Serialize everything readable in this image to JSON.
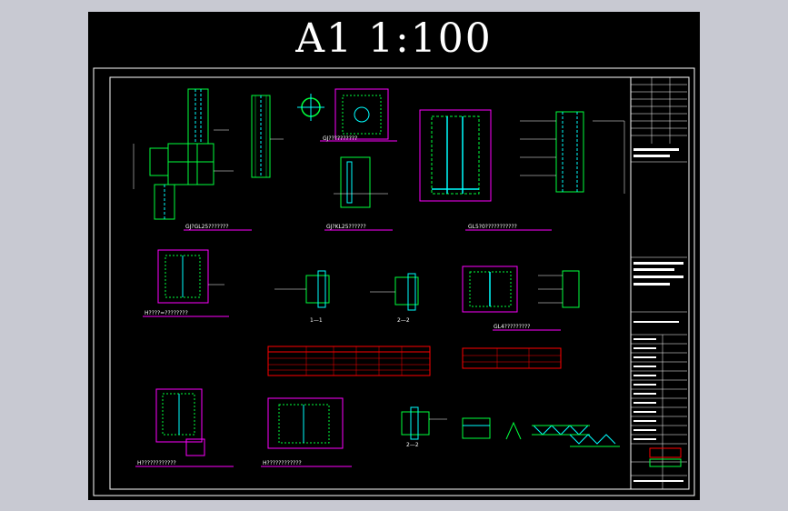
{
  "sheet": {
    "title": "A1 1:100"
  },
  "details": {
    "d1": "GJ?GL25???????",
    "d2": "GJ?KL25??????",
    "d3": "GL5?0???????????",
    "d4": "GL4?????????",
    "d5": "H????=????????",
    "d6": "H????????????",
    "d7": "H????????????",
    "d8": "GJ??????????",
    "s1": "1—1",
    "s2": "2—2",
    "s3": "2—2"
  },
  "colors": {
    "frame": "#ffffff",
    "rebar": "#00ff3c",
    "column": "#00ffff",
    "dim": "#ff00ff",
    "table": "#ff0000",
    "title_text": "#ffffff"
  }
}
